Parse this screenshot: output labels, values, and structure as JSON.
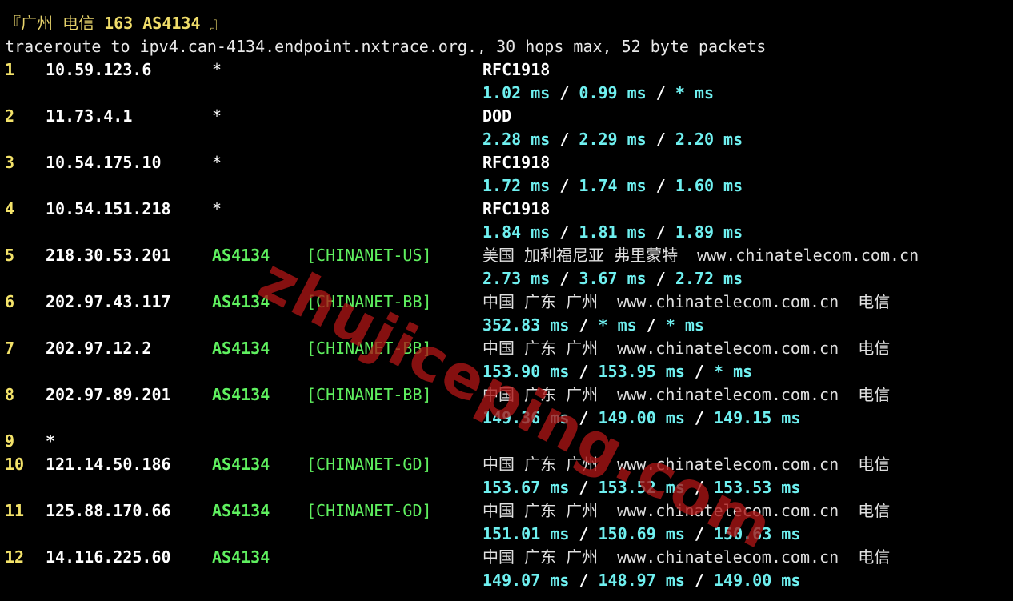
{
  "header": {
    "bracket_open": "『",
    "location": "广州 电信",
    "strong": "163 AS4134",
    "bracket_close": "』"
  },
  "command_line": "traceroute to ipv4.can-4134.endpoint.nxtrace.org., 30 hops max, 52 byte packets",
  "hops": [
    {
      "num": "1",
      "ip": "10.59.123.6",
      "asn": "*",
      "net": "",
      "tag": "RFC1918",
      "geo": "",
      "rtt": [
        "1.02 ms",
        "0.99 ms",
        "* ms"
      ]
    },
    {
      "num": "2",
      "ip": "11.73.4.1",
      "asn": "*",
      "net": "",
      "tag": "DOD",
      "geo": "",
      "rtt": [
        "2.28 ms",
        "2.29 ms",
        "2.20 ms"
      ]
    },
    {
      "num": "3",
      "ip": "10.54.175.10",
      "asn": "*",
      "net": "",
      "tag": "RFC1918",
      "geo": "",
      "rtt": [
        "1.72 ms",
        "1.74 ms",
        "1.60 ms"
      ]
    },
    {
      "num": "4",
      "ip": "10.54.151.218",
      "asn": "*",
      "net": "",
      "tag": "RFC1918",
      "geo": "",
      "rtt": [
        "1.84 ms",
        "1.81 ms",
        "1.89 ms"
      ]
    },
    {
      "num": "5",
      "ip": "218.30.53.201",
      "asn": "AS4134",
      "net": "[CHINANET-US]",
      "tag": "",
      "geo": "美国 加利福尼亚 弗里蒙特  www.chinatelecom.com.cn",
      "rtt": [
        "2.73 ms",
        "3.67 ms",
        "2.72 ms"
      ]
    },
    {
      "num": "6",
      "ip": "202.97.43.117",
      "asn": "AS4134",
      "net": "[CHINANET-BB]",
      "tag": "",
      "geo": "中国 广东 广州  www.chinatelecom.com.cn  电信",
      "rtt": [
        "352.83 ms",
        "* ms",
        "* ms"
      ]
    },
    {
      "num": "7",
      "ip": "202.97.12.2",
      "asn": "AS4134",
      "net": "[CHINANET-BB]",
      "tag": "",
      "geo": "中国 广东 广州  www.chinatelecom.com.cn  电信",
      "rtt": [
        "153.90 ms",
        "153.95 ms",
        "* ms"
      ]
    },
    {
      "num": "8",
      "ip": "202.97.89.201",
      "asn": "AS4134",
      "net": "[CHINANET-BB]",
      "tag": "",
      "geo": "中国 广东 广州  www.chinatelecom.com.cn  电信",
      "rtt": [
        "149.36 ms",
        "149.00 ms",
        "149.15 ms"
      ]
    },
    {
      "num": "9",
      "ip": "*",
      "asn": "",
      "net": "",
      "tag": "",
      "geo": "",
      "rtt": []
    },
    {
      "num": "10",
      "ip": "121.14.50.186",
      "asn": "AS4134",
      "net": "[CHINANET-GD]",
      "tag": "",
      "geo": "中国 广东 广州  www.chinatelecom.com.cn  电信",
      "rtt": [
        "153.67 ms",
        "153.52 ms",
        "153.53 ms"
      ]
    },
    {
      "num": "11",
      "ip": "125.88.170.66",
      "asn": "AS4134",
      "net": "[CHINANET-GD]",
      "tag": "",
      "geo": "中国 广东 广州  www.chinatelecom.com.cn  电信",
      "rtt": [
        "151.01 ms",
        "150.69 ms",
        "150.63 ms"
      ]
    },
    {
      "num": "12",
      "ip": "14.116.225.60",
      "asn": "AS4134",
      "net": "",
      "tag": "",
      "geo": "中国 广东 广州  www.chinatelecom.com.cn  电信",
      "rtt": [
        "149.07 ms",
        "148.97 ms",
        "149.00 ms"
      ]
    }
  ],
  "rtt_separator": " / ",
  "watermark": "zhujiceping.com",
  "colors": {
    "background": "#000000",
    "hop_number": "#f4e36a",
    "asn": "#5ff05f",
    "rtt": "#6ff0f0",
    "watermark": "#aa1414"
  }
}
